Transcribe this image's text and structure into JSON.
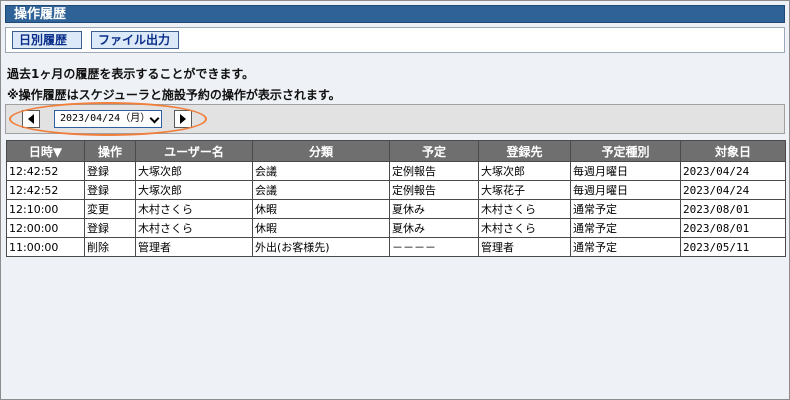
{
  "window": {
    "title": "操作履歴"
  },
  "toolbar": {
    "daily_button": "日別履歴",
    "file_button": "ファイル出力"
  },
  "description": {
    "line1": "過去1ヶ月の履歴を表示することができます。",
    "line2": "※操作履歴はスケジューラと施設予約の操作が表示されます。"
  },
  "date_nav": {
    "selected_date": "2023/04/24（月）"
  },
  "table": {
    "headers": [
      "日時▼",
      "操作",
      "ユーザー名",
      "分類",
      "予定",
      "登録先",
      "予定種別",
      "対象日"
    ],
    "rows": [
      [
        "12:42:52",
        "登録",
        "大塚次郎",
        "会議",
        "定例報告",
        "大塚次郎",
        "毎週月曜日",
        "2023/04/24"
      ],
      [
        "12:42:52",
        "登録",
        "大塚次郎",
        "会議",
        "定例報告",
        "大塚花子",
        "毎週月曜日",
        "2023/04/24"
      ],
      [
        "12:10:00",
        "変更",
        "木村さくら",
        "休暇",
        "夏休み",
        "木村さくら",
        "通常予定",
        "2023/08/01"
      ],
      [
        "12:00:00",
        "登録",
        "木村さくら",
        "休暇",
        "夏休み",
        "木村さくら",
        "通常予定",
        "2023/08/01"
      ],
      [
        "11:00:00",
        "削除",
        "管理者",
        "外出(お客様先)",
        "－－－－",
        "管理者",
        "通常予定",
        "2023/05/11"
      ]
    ]
  },
  "colors": {
    "title_bar": "#2f6296",
    "header_bg": "#6f6f6f",
    "highlight": "#f07f3c",
    "button_text": "#0b2f8a"
  }
}
